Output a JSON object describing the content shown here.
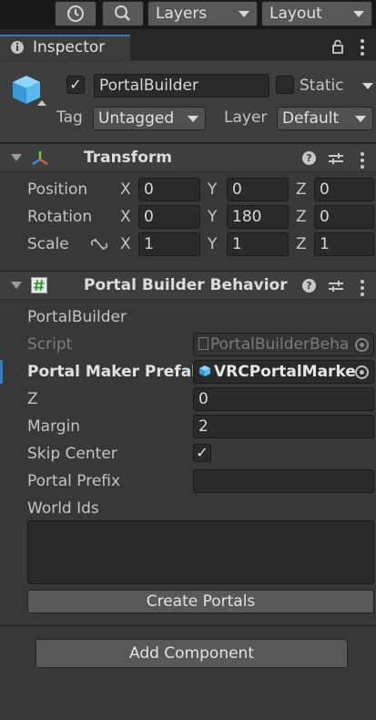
{
  "toolbar": {
    "layers_label": "Layers",
    "layout_label": "Layout"
  },
  "tab": {
    "label": "Inspector"
  },
  "object": {
    "name": "PortalBuilder",
    "active": true,
    "static_label": "Static",
    "static_checked": false,
    "tag_label": "Tag",
    "tag_value": "Untagged",
    "layer_label": "Layer",
    "layer_value": "Default"
  },
  "transform": {
    "title": "Transform",
    "rows": [
      {
        "label": "Position",
        "x": "0",
        "y": "0",
        "z": "0"
      },
      {
        "label": "Rotation",
        "x": "0",
        "y": "180",
        "z": "0"
      },
      {
        "label": "Scale",
        "x": "1",
        "y": "1",
        "z": "1"
      }
    ],
    "axis_labels": {
      "x": "X",
      "y": "Y",
      "z": "Z"
    }
  },
  "behavior": {
    "title": "Portal Builder Behavior (S",
    "object_label": "PortalBuilder",
    "script_label": "Script",
    "script_value": "PortalBuilderBeha",
    "prefab_label": "Portal Maker Prefal",
    "prefab_value": "VRCPortalMarke",
    "z_label": "Z",
    "z_value": "0",
    "margin_label": "Margin",
    "margin_value": "2",
    "skip_center_label": "Skip Center",
    "skip_center_checked": true,
    "portal_prefix_label": "Portal Prefix",
    "portal_prefix_value": "",
    "world_ids_label": "World Ids",
    "world_ids_value": "",
    "create_button": "Create Portals"
  },
  "add_component_button": "Add Component",
  "icons": [
    "history-icon",
    "search-icon",
    "info-icon",
    "lock-icon",
    "menu-dots-icon",
    "cube-icon",
    "transform-icon",
    "script-hash-icon",
    "help-icon",
    "presets-icon",
    "link-scale-icon",
    "object-picker-icon",
    "checkmark-icon"
  ],
  "colors": {
    "accent": "#3a79bb",
    "cube": "#4da9e4",
    "script_icon": "#2e9d2e"
  }
}
